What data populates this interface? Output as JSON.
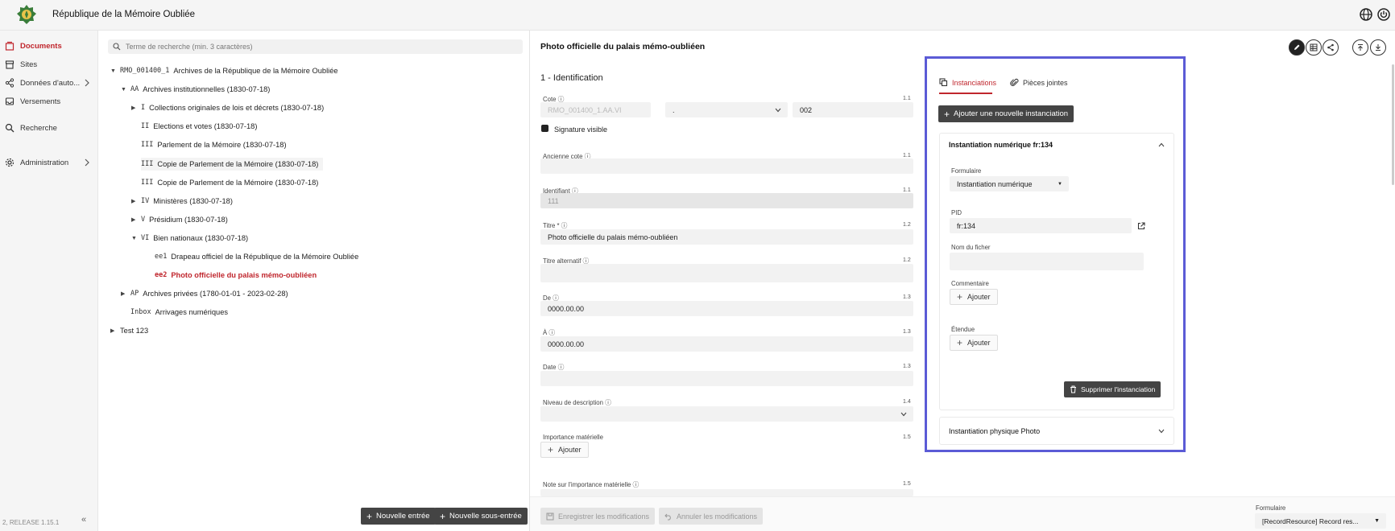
{
  "app": {
    "title": "République de la Mémoire Oubliée",
    "release": "2, RELEASE 1.15.1",
    "collapse_glyph": "«"
  },
  "sidebar": {
    "items": [
      {
        "label": "Documents",
        "icon": "documents-icon"
      },
      {
        "label": "Sites",
        "icon": "sites-icon"
      },
      {
        "label": "Données d'auto...",
        "icon": "share-icon"
      },
      {
        "label": "Versements",
        "icon": "inbox-icon"
      },
      {
        "label": "Recherche",
        "icon": "search-icon"
      },
      {
        "label": "Administration",
        "icon": "gear-icon"
      }
    ]
  },
  "tree": {
    "search_placeholder": "Terme de recherche (min. 3 caractères)",
    "rows": [
      {
        "code": "RMO_001400_1",
        "label": "Archives de la République de la Mémoire Oubliée"
      },
      {
        "code": "AA",
        "label": "Archives institutionnelles (1830-07-18)"
      },
      {
        "code": "I",
        "label": "Collections originales de lois et décrets (1830-07-18)"
      },
      {
        "code": "II",
        "label": "Elections et votes (1830-07-18)"
      },
      {
        "code": "III",
        "label": "Parlement de la Mémoire (1830-07-18)"
      },
      {
        "code": "III",
        "label": "Copie de Parlement de la Mémoire (1830-07-18)"
      },
      {
        "code": "III",
        "label": "Copie de Parlement de la Mémoire (1830-07-18)"
      },
      {
        "code": "IV",
        "label": "Ministères (1830-07-18)"
      },
      {
        "code": "V",
        "label": "Présidium (1830-07-18)"
      },
      {
        "code": "VI",
        "label": "Bien nationaux (1830-07-18)"
      },
      {
        "code": "ee1",
        "label": "Drapeau officiel de la République de la Mémoire Oubliée"
      },
      {
        "code": "ee2",
        "label": "Photo officielle du palais mémo-oubliéen"
      },
      {
        "code": "AP",
        "label": "Archives privées (1780-01-01 - 2023-02-28)"
      },
      {
        "code": "Inbox",
        "label": "Arrivages numériques"
      },
      {
        "code": "",
        "label": "Test 123"
      }
    ],
    "btn_new_entry": "Nouvelle entrée",
    "btn_new_subentry": "Nouvelle sous-entrée"
  },
  "form": {
    "title": "Photo officielle du palais mémo-oubliéen",
    "section": "1 - Identification",
    "cote_label": "Cote",
    "cote_value": "RMO_001400_1.AA.VI",
    "cote_sep": ".",
    "cote_suffix": "002",
    "signature_label": "Signature visible",
    "ancienne_cote_label": "Ancienne cote",
    "identifiant_label": "Identifiant",
    "identifiant_value": "111",
    "titre_label": "Titre *",
    "titre_value": "Photo officielle du palais mémo-oubliéen",
    "titre_alt_label": "Titre alternatif",
    "de_label": "De",
    "de_value": "0000.00.00",
    "a_label": "À",
    "a_value": "0000.00.00",
    "date_label": "Date",
    "niveau_label": "Niveau de description",
    "importance_label": "Importance matérielle",
    "importance_btn": "Ajouter",
    "note_importance_label": "Note sur l'importance matérielle",
    "nums": [
      "1.1",
      "1.1",
      "1.1",
      "1.2",
      "1.2",
      "1.3",
      "1.3",
      "1.3",
      "1.4",
      "1.5",
      "1.5"
    ],
    "btn_save": "Enregistrer les modifications",
    "btn_cancel": "Annuler les modifications",
    "formulaire_label": "Formulaire",
    "formulaire_value": "[RecordResource] Record res..."
  },
  "panel": {
    "tab_instanciations": "Instanciations",
    "tab_pieces": "Pièces jointes",
    "btn_add": "Ajouter une nouvelle instanciation",
    "inst1_title": "Instantiation numérique fr:134",
    "formulaire_label": "Formulaire",
    "formulaire_value": "Instantiation numérique",
    "pid_label": "PID",
    "pid_value": "fr:134",
    "nom_label": "Nom du ficher",
    "commentaire_label": "Commentaire",
    "commentaire_btn": "Ajouter",
    "etendue_label": "Étendue",
    "etendue_btn": "Ajouter",
    "btn_delete": "Supprimer l'instanciation",
    "inst2_title": "Instantiation physique Photo"
  },
  "colors": {
    "accent": "#c0262d",
    "highlight_border": "#5b5bd6",
    "dark_button": "#444444"
  }
}
